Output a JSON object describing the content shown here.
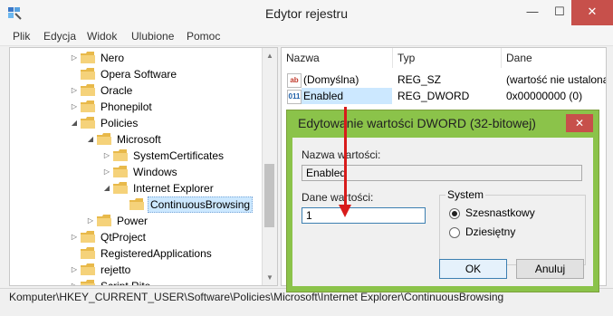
{
  "window": {
    "title": "Edytor rejestru"
  },
  "menu": [
    "Plik",
    "Edycja",
    "Widok",
    "Ulubione",
    "Pomoc"
  ],
  "tree": {
    "items": [
      {
        "label": "Nero",
        "exp": "▷",
        "selected": false
      },
      {
        "label": "Opera Software",
        "exp": "",
        "selected": false
      },
      {
        "label": "Oracle",
        "exp": "▷",
        "selected": false
      },
      {
        "label": "Phonepilot",
        "exp": "▷",
        "selected": false
      },
      {
        "label": "Policies",
        "exp": "◢",
        "selected": false
      },
      {
        "label": "Microsoft",
        "exp": "◢",
        "selected": false
      },
      {
        "label": "SystemCertificates",
        "exp": "▷",
        "selected": false
      },
      {
        "label": "Windows",
        "exp": "▷",
        "selected": false
      },
      {
        "label": "Internet Explorer",
        "exp": "◢",
        "selected": false
      },
      {
        "label": "ContinuousBrowsing",
        "exp": "",
        "selected": true
      },
      {
        "label": "Power",
        "exp": "▷",
        "selected": false
      },
      {
        "label": "QtProject",
        "exp": "▷",
        "selected": false
      },
      {
        "label": "RegisteredApplications",
        "exp": "",
        "selected": false
      },
      {
        "label": "rejetto",
        "exp": "▷",
        "selected": false
      },
      {
        "label": "Script Rite",
        "exp": "▷",
        "selected": false
      }
    ]
  },
  "values": {
    "columns": [
      "Nazwa",
      "Typ",
      "Dane"
    ],
    "rows": [
      {
        "icon": "ab",
        "name": "(Domyślna)",
        "type": "REG_SZ",
        "data": "(wartość nie ustalona)"
      },
      {
        "icon": "011",
        "name": "Enabled",
        "type": "REG_DWORD",
        "data": "0x00000000 (0)"
      }
    ]
  },
  "statusbar": {
    "path": "Komputer\\HKEY_CURRENT_USER\\Software\\Policies\\Microsoft\\Internet Explorer\\ContinuousBrowsing"
  },
  "dialog": {
    "title": "Edytowanie wartości DWORD (32-bitowej)",
    "close": "✕",
    "name_label": "Nazwa wartości:",
    "name_value": "Enabled",
    "data_label": "Dane wartości:",
    "data_value": "1",
    "system_label": "System",
    "radio_hex": "Szesnastkowy",
    "radio_dec": "Dziesiętny",
    "ok": "OK",
    "cancel": "Anuluj"
  },
  "colors": {
    "dialog_frame": "#8bc34a",
    "close_red": "#c7504b",
    "arrow": "#d81b1b",
    "selection": "#cce8ff",
    "folder": "#e8b94a"
  }
}
